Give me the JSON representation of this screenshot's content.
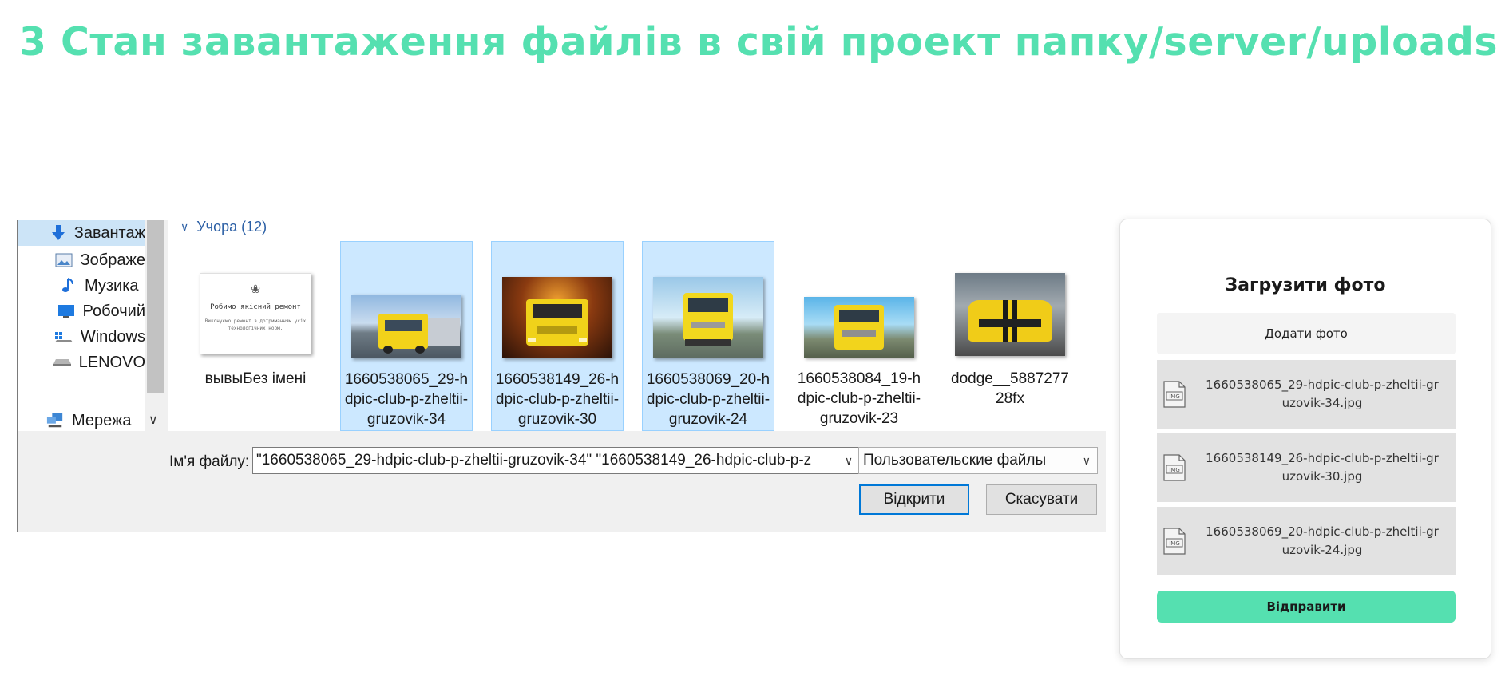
{
  "heading": "3 Стан завантаження файлів в свій проект папку/server/uploads",
  "dialog": {
    "nav_items": [
      {
        "label": "Завантаж",
        "icon": "download-arrow-icon"
      },
      {
        "label": "Зображе",
        "icon": "pictures-icon"
      },
      {
        "label": "Музика",
        "icon": "music-note-icon"
      },
      {
        "label": "Робочий",
        "icon": "desktop-icon"
      },
      {
        "label": "Windows",
        "icon": "drive-icon"
      },
      {
        "label": "LENOVO",
        "icon": "drive-icon"
      },
      {
        "label": "Мережа",
        "icon": "network-icon"
      }
    ],
    "group_header": "Учора (12)",
    "files": [
      {
        "name": "вывыБез імені",
        "selected": false,
        "doc": {
          "line1": "Робимо якісний ремонт",
          "line2": "Виконуємо ремонт з дотриманням усіх технологічних норм."
        }
      },
      {
        "name": "1660538065_29-hdpic-club-p-zheltii-gruzovik-34",
        "selected": true
      },
      {
        "name": "1660538149_26-hdpic-club-p-zheltii-gruzovik-30",
        "selected": true
      },
      {
        "name": "1660538069_20-hdpic-club-p-zheltii-gruzovik-24",
        "selected": true
      },
      {
        "name": "1660538084_19-hdpic-club-p-zheltii-gruzovik-23",
        "selected": false
      },
      {
        "name": "dodge__588727728fx",
        "selected": false
      }
    ],
    "filename_label": "Ім'я файлу:",
    "filename_value": "\"1660538065_29-hdpic-club-p-zheltii-gruzovik-34\" \"1660538149_26-hdpic-club-p-z",
    "filetype_value": "Пользовательские файлы",
    "open_button": "Відкрити",
    "cancel_button": "Скасувати",
    "selection_color": "#cce8ff"
  },
  "upload": {
    "title": "Загрузити фото",
    "add_button": "Додати фото",
    "icon_label": "IMG",
    "files": [
      "1660538065_29-hdpic-club-p-zheltii-gruzovik-34.jpg",
      "1660538149_26-hdpic-club-p-zheltii-gruzovik-30.jpg",
      "1660538069_20-hdpic-club-p-zheltii-gruzovik-24.jpg"
    ],
    "send_button": "Відправити",
    "accent_color": "#55e0b0"
  }
}
